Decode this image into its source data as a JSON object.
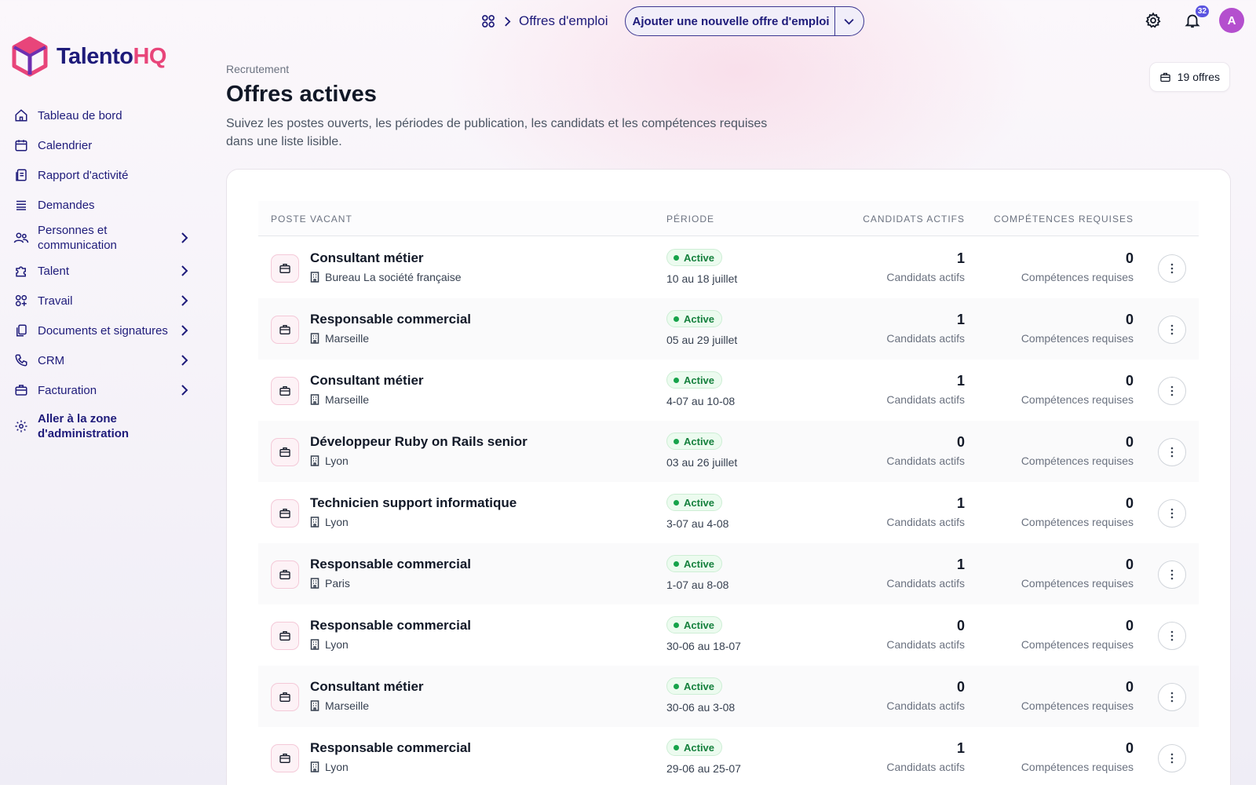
{
  "brand": {
    "name_main": "Talento",
    "name_accent": "HQ"
  },
  "sidebar": {
    "items": [
      {
        "label": "Tableau de bord",
        "icon": "home-icon",
        "chevron": false
      },
      {
        "label": "Calendrier",
        "icon": "calendar-icon",
        "chevron": false
      },
      {
        "label": "Rapport d'activité",
        "icon": "report-icon",
        "chevron": false
      },
      {
        "label": "Demandes",
        "icon": "list-icon",
        "chevron": false
      },
      {
        "label": "Personnes et communication",
        "icon": "people-icon",
        "chevron": true
      },
      {
        "label": "Talent",
        "icon": "puzzle-icon",
        "chevron": true
      },
      {
        "label": "Travail",
        "icon": "apps-icon",
        "chevron": true
      },
      {
        "label": "Documents et signatures",
        "icon": "documents-icon",
        "chevron": true
      },
      {
        "label": "CRM",
        "icon": "phone-icon",
        "chevron": true
      },
      {
        "label": "Facturation",
        "icon": "briefcase-icon",
        "chevron": true
      },
      {
        "label": "Aller à la zone d'administration",
        "icon": "gear-icon",
        "chevron": false
      }
    ]
  },
  "topbar": {
    "breadcrumb": "Offres d'emploi",
    "add_button": "Ajouter une nouvelle offre d'emploi",
    "notifications_count": "32",
    "avatar_initial": "A"
  },
  "header": {
    "eyebrow": "Recrutement",
    "title": "Offres actives",
    "description": "Suivez les postes ouverts, les périodes de publication, les candidats et les compétences requises dans une liste lisible.",
    "count_label": "19 offres"
  },
  "table": {
    "columns": {
      "job": "Poste vacant",
      "period": "Période",
      "candidates": "Candidats actifs",
      "skills": "Compétences requises"
    },
    "candidates_label": "Candidats actifs",
    "skills_label": "Compétences requises",
    "rows": [
      {
        "title": "Consultant métier",
        "location": "Bureau La société française",
        "status": "Active",
        "period": "10 au 18 juillet",
        "candidates": "1",
        "skills": "0"
      },
      {
        "title": "Responsable commercial",
        "location": "Marseille",
        "status": "Active",
        "period": "05 au 29 juillet",
        "candidates": "1",
        "skills": "0"
      },
      {
        "title": "Consultant métier",
        "location": "Marseille",
        "status": "Active",
        "period": "4-07 au 10-08",
        "candidates": "1",
        "skills": "0"
      },
      {
        "title": "Développeur Ruby on Rails senior",
        "location": "Lyon",
        "status": "Active",
        "period": "03 au 26 juillet",
        "candidates": "0",
        "skills": "0"
      },
      {
        "title": "Technicien support informatique",
        "location": "Lyon",
        "status": "Active",
        "period": "3-07 au 4-08",
        "candidates": "1",
        "skills": "0"
      },
      {
        "title": "Responsable commercial",
        "location": "Paris",
        "status": "Active",
        "period": "1-07 au 8-08",
        "candidates": "1",
        "skills": "0"
      },
      {
        "title": "Responsable commercial",
        "location": "Lyon",
        "status": "Active",
        "period": "30-06 au 18-07",
        "candidates": "0",
        "skills": "0"
      },
      {
        "title": "Consultant métier",
        "location": "Marseille",
        "status": "Active",
        "period": "30-06 au 3-08",
        "candidates": "0",
        "skills": "0"
      },
      {
        "title": "Responsable commercial",
        "location": "Lyon",
        "status": "Active",
        "period": "29-06 au 25-07",
        "candidates": "1",
        "skills": "0"
      }
    ]
  },
  "colors": {
    "primary": "#1e1b7a",
    "accent": "#e8457a",
    "success": "#15803d"
  }
}
